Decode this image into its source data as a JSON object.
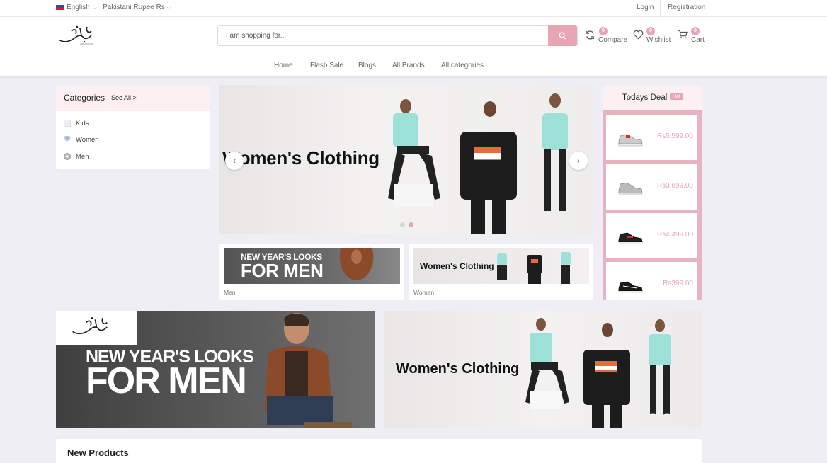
{
  "topbar": {
    "language": "English",
    "currency": "Pakistani Rupee Rs",
    "login": "Login",
    "registration": "Registration"
  },
  "header": {
    "logo_alt": "Fashion logo",
    "search_placeholder": "I am shopping for...",
    "compare": {
      "label": "Compare",
      "count": "0"
    },
    "wishlist": {
      "label": "Wishlist",
      "count": "0"
    },
    "cart": {
      "label": "Cart",
      "count": "0"
    }
  },
  "nav": {
    "items": [
      "Home",
      "Flash Sale",
      "Blogs",
      "All Brands",
      "All categories"
    ]
  },
  "categories": {
    "title": "Categories",
    "see_all": "See All >",
    "items": [
      "Kids",
      "Women",
      "Men"
    ]
  },
  "slider": {
    "title": "Women's Clothing",
    "prev_icon": "chevron-left-icon",
    "next_icon": "chevron-right-icon",
    "slide_count": 2,
    "active_slide": 2
  },
  "small_banners": [
    {
      "line1": "NEW YEAR'S LOOKS",
      "line2": "FOR MEN",
      "caption": "Men"
    },
    {
      "title": "Women's Clothing",
      "caption": "Women"
    }
  ],
  "deals": {
    "title": "Todays Deal",
    "hot": "Hot",
    "items": [
      {
        "price": "Rs5,599.00"
      },
      {
        "price": "Rs3,699.00"
      },
      {
        "price": "Rs4,499.00"
      },
      {
        "price": "Rs399.00"
      }
    ]
  },
  "big_banners": [
    {
      "line1": "NEW YEAR'S LOOKS",
      "line2": "FOR MEN"
    },
    {
      "title": "Women's Clothing"
    }
  ],
  "new_products": {
    "title": "New Products"
  },
  "colors": {
    "accent": "#e8a6b5",
    "page_bg": "#eeeef4",
    "panel_tint": "#fcf0f2"
  }
}
